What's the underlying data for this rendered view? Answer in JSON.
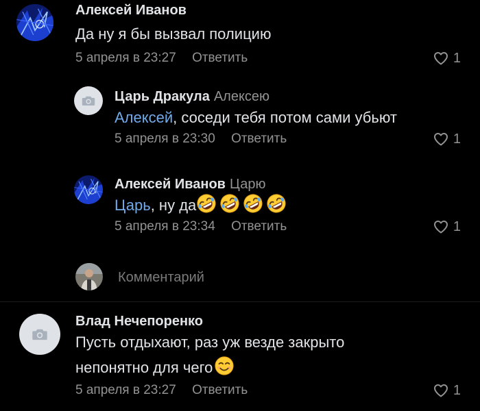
{
  "comments": [
    {
      "author": "Алексей Иванов",
      "reply_to": "",
      "mention": "",
      "text": "Да ну я бы вызвал полицию",
      "date": "5 апреля в 23:27",
      "reply_label": "Ответить",
      "likes": "1",
      "avatar": "blue-abstract-avatar"
    },
    {
      "author": "Царь Дракула",
      "reply_to": "Алексею",
      "mention": "Алексей",
      "text": ", соседи тебя потом сами убьют",
      "date": "5 апреля в 23:30",
      "reply_label": "Ответить",
      "likes": "1",
      "avatar": "camera-placeholder-avatar"
    },
    {
      "author": "Алексей Иванов",
      "reply_to": "Царю",
      "mention": "Царь",
      "text": ", ну да",
      "emojis": [
        "rofl-emoji",
        "rofl-emoji",
        "rofl-emoji",
        "rofl-emoji"
      ],
      "date": "5 апреля в 23:34",
      "reply_label": "Ответить",
      "likes": "1",
      "avatar": "blue-abstract-avatar"
    },
    {
      "author": "Влад Нечепоренко",
      "reply_to": "",
      "mention": "",
      "text_line1": "Пусть отдыхают, раз уж везде закрыто",
      "text_line2": "непонятно для чего",
      "emojis": [
        "smiling-emoji"
      ],
      "date": "5 апреля в 23:27",
      "reply_label": "Ответить",
      "likes": "1",
      "avatar": "camera-placeholder-avatar"
    }
  ],
  "compose": {
    "placeholder": "Комментарий",
    "avatar": "user-photo-avatar"
  },
  "colors": {
    "background": "#000000",
    "text": "#e1e3e6",
    "secondary": "#939393",
    "mention": "#71aaeb",
    "avatar_placeholder": "#dfe3e8"
  }
}
